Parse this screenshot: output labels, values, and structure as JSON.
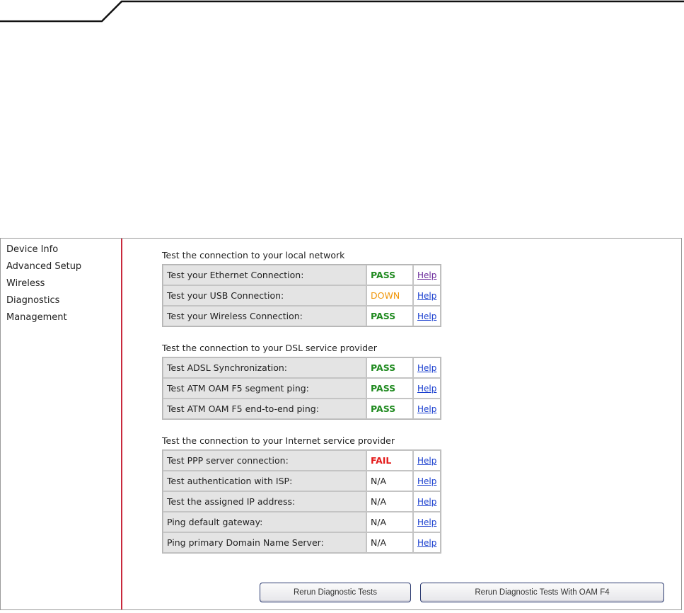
{
  "sidebar": {
    "items": [
      {
        "label": "Device Info"
      },
      {
        "label": "Advanced Setup"
      },
      {
        "label": "Wireless"
      },
      {
        "label": "Diagnostics"
      },
      {
        "label": "Management"
      }
    ]
  },
  "sections": [
    {
      "title": "Test the connection to your local network",
      "rows": [
        {
          "label": "Test your Ethernet Connection:",
          "status": "PASS",
          "status_color": "#1f8a1f",
          "help": "Help",
          "help_visited": true
        },
        {
          "label": "Test your USB Connection:",
          "status": "DOWN",
          "status_color": "#f0960a",
          "help": "Help"
        },
        {
          "label": "Test your Wireless Connection:",
          "status": "PASS",
          "status_color": "#1f8a1f",
          "help": "Help"
        }
      ]
    },
    {
      "title": "Test the connection to your DSL service provider",
      "rows": [
        {
          "label": "Test ADSL Synchronization:",
          "status": "PASS",
          "status_color": "#1f8a1f",
          "help": "Help"
        },
        {
          "label": "Test ATM OAM F5 segment ping:",
          "status": "PASS",
          "status_color": "#1f8a1f",
          "help": "Help"
        },
        {
          "label": "Test ATM OAM F5 end-to-end ping:",
          "status": "PASS",
          "status_color": "#1f8a1f",
          "help": "Help"
        }
      ]
    },
    {
      "title": "Test the connection to your Internet service provider",
      "rows": [
        {
          "label": "Test PPP server connection:",
          "status": "FAIL",
          "status_color": "#e41b1b",
          "help": "Help"
        },
        {
          "label": "Test authentication with ISP:",
          "status": "N/A",
          "help": "Help"
        },
        {
          "label": "Test the assigned IP address:",
          "status": "N/A",
          "help": "Help"
        },
        {
          "label": "Ping default gateway:",
          "status": "N/A",
          "help": "Help"
        },
        {
          "label": "Ping primary Domain Name Server:",
          "status": "N/A",
          "help": "Help"
        }
      ]
    }
  ],
  "buttons": {
    "rerun": "Rerun Diagnostic Tests",
    "rerun_oam_f4": "Rerun Diagnostic Tests With OAM F4"
  },
  "colors": {
    "sidebar_divider": "#c8283c",
    "pass": "#1f8a1f",
    "down": "#f0960a",
    "fail": "#e41b1b",
    "link": "#1a3fcf"
  }
}
